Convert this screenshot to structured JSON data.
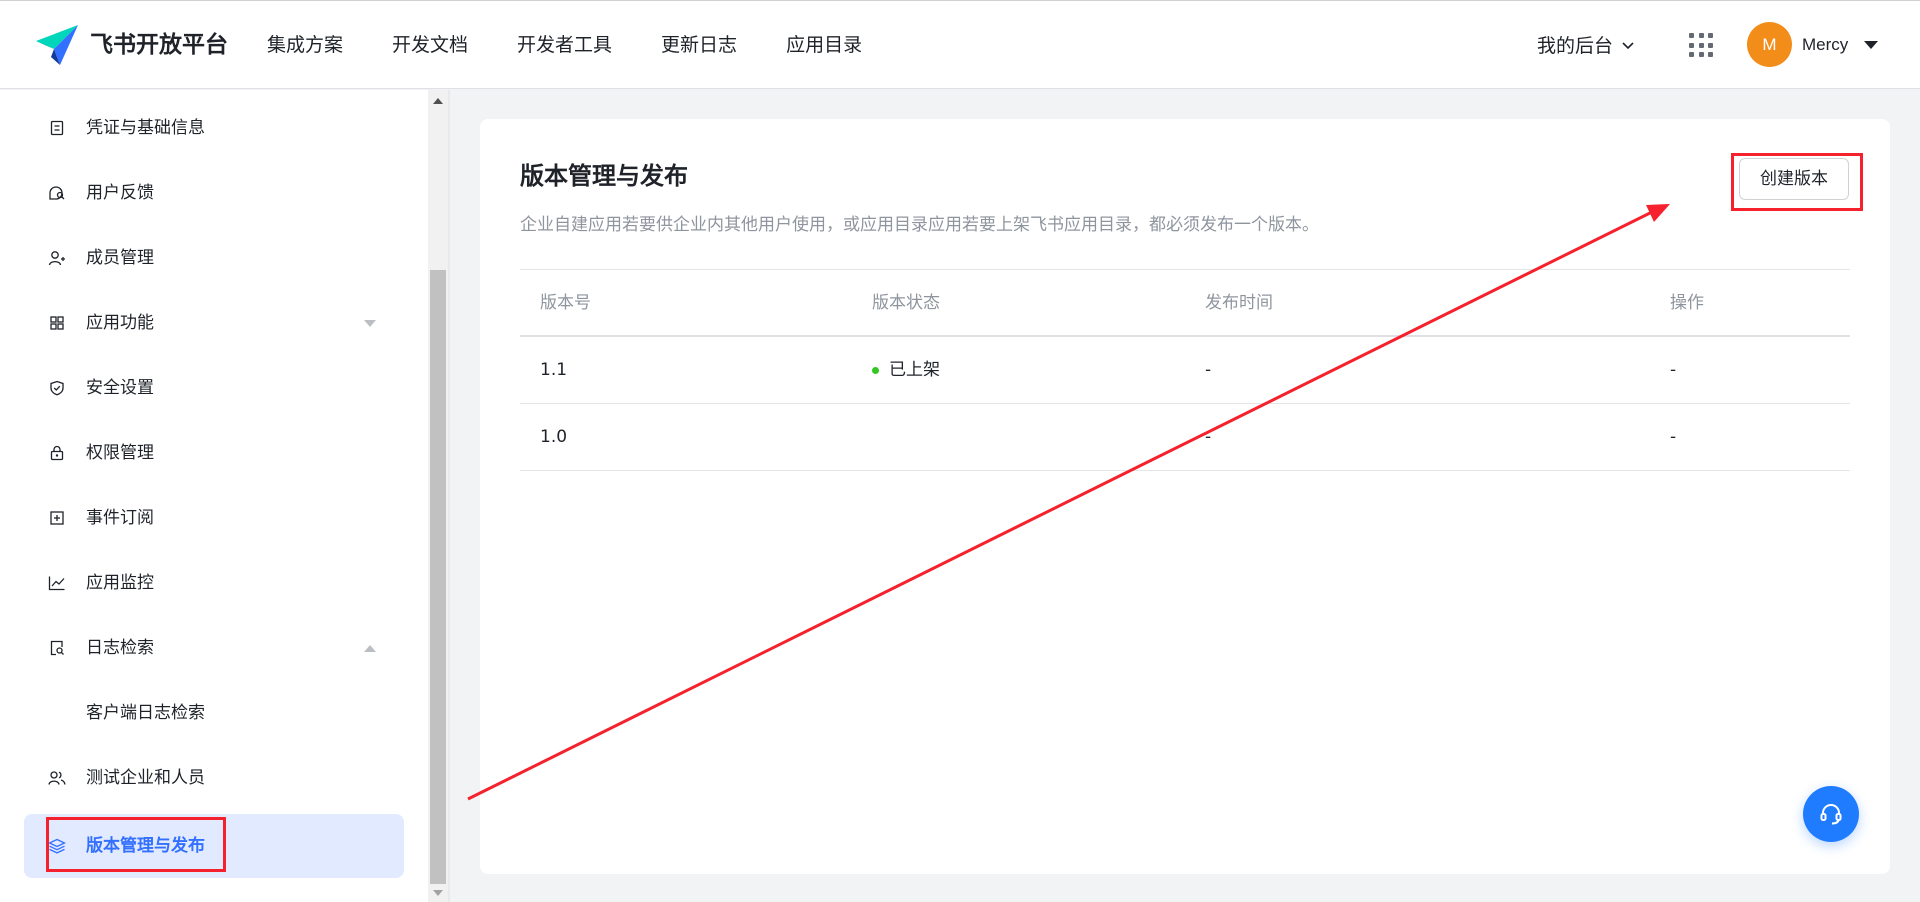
{
  "header": {
    "brand": "飞书开放平台",
    "nav": [
      "集成方案",
      "开发文档",
      "开发者工具",
      "更新日志",
      "应用目录"
    ],
    "backend_label": "我的后台",
    "avatar_letter": "M",
    "user_name": "Mercy",
    "avatar_color": "#f28d1a"
  },
  "sidebar": {
    "items": [
      {
        "label": "凭证与基础信息",
        "icon": "credential-icon"
      },
      {
        "label": "用户反馈",
        "icon": "feedback-icon"
      },
      {
        "label": "成员管理",
        "icon": "member-icon"
      },
      {
        "label": "应用功能",
        "icon": "grid-icon",
        "arrow": "down"
      },
      {
        "label": "安全设置",
        "icon": "shield-icon"
      },
      {
        "label": "权限管理",
        "icon": "lock-icon"
      },
      {
        "label": "事件订阅",
        "icon": "event-icon"
      },
      {
        "label": "应用监控",
        "icon": "chart-icon"
      },
      {
        "label": "日志检索",
        "icon": "log-search-icon",
        "arrow": "up"
      },
      {
        "label": "客户端日志检索",
        "sub": true
      },
      {
        "label": "测试企业和人员",
        "icon": "users-icon"
      },
      {
        "label": "版本管理与发布",
        "icon": "layers-icon",
        "active": true
      }
    ]
  },
  "main": {
    "title": "版本管理与发布",
    "description": "企业自建应用若要供企业内其他用户使用，或应用目录应用若要上架飞书应用目录，都必须发布一个版本。",
    "create_button": "创建版本",
    "table": {
      "headers": [
        "版本号",
        "版本状态",
        "发布时间",
        "操作"
      ],
      "rows": [
        {
          "version": "1.1",
          "status": "已上架",
          "time": "-",
          "action": "-"
        },
        {
          "version": "1.0",
          "status": "",
          "time": "-",
          "action": "-"
        }
      ]
    }
  },
  "colors": {
    "accent": "#3370ff",
    "active_bg": "#e1eaff",
    "status_green": "#34c724",
    "annotation_red": "#f5222d",
    "help_blue": "#1f7cff"
  }
}
